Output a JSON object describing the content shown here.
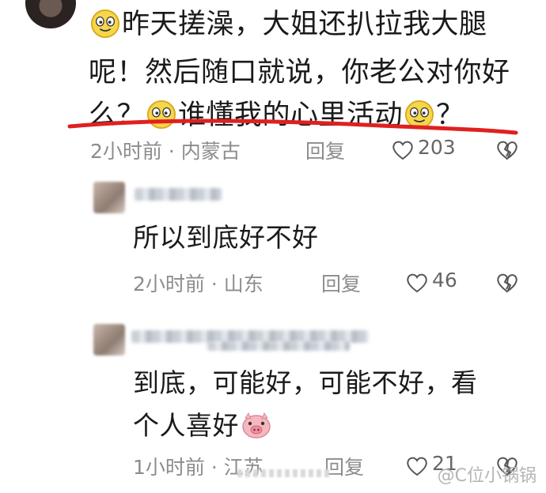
{
  "comment": {
    "line1": "昨天搓澡，大姐还扒拉我大腿",
    "line2": "呢！然后随口就说，你老公对你好",
    "line3_a": "么？",
    "line3_b": "谁懂我的心里活动",
    "line3_c": "？",
    "time": "2小时前",
    "location": "内蒙古",
    "reply_label": "回复",
    "likes": "203",
    "emoji_icon": "smile-face-icon"
  },
  "replies": [
    {
      "text": "所以到底好不好",
      "time": "2小时前",
      "location": "山东",
      "reply_label": "回复",
      "likes": "46"
    },
    {
      "text_line1": "到底，可能好，可能不好，看",
      "text_line2": "个人喜好",
      "time": "1小时前",
      "location": "江苏",
      "reply_label": "回复",
      "likes": "21",
      "emoji_icon": "pig-face-icon"
    }
  ],
  "separator": "·",
  "watermark": "@C位小锅锅",
  "colors": {
    "underline": "#e02020",
    "meta": "#8c8c8c",
    "emoji_yellow": "#f6d64a"
  }
}
